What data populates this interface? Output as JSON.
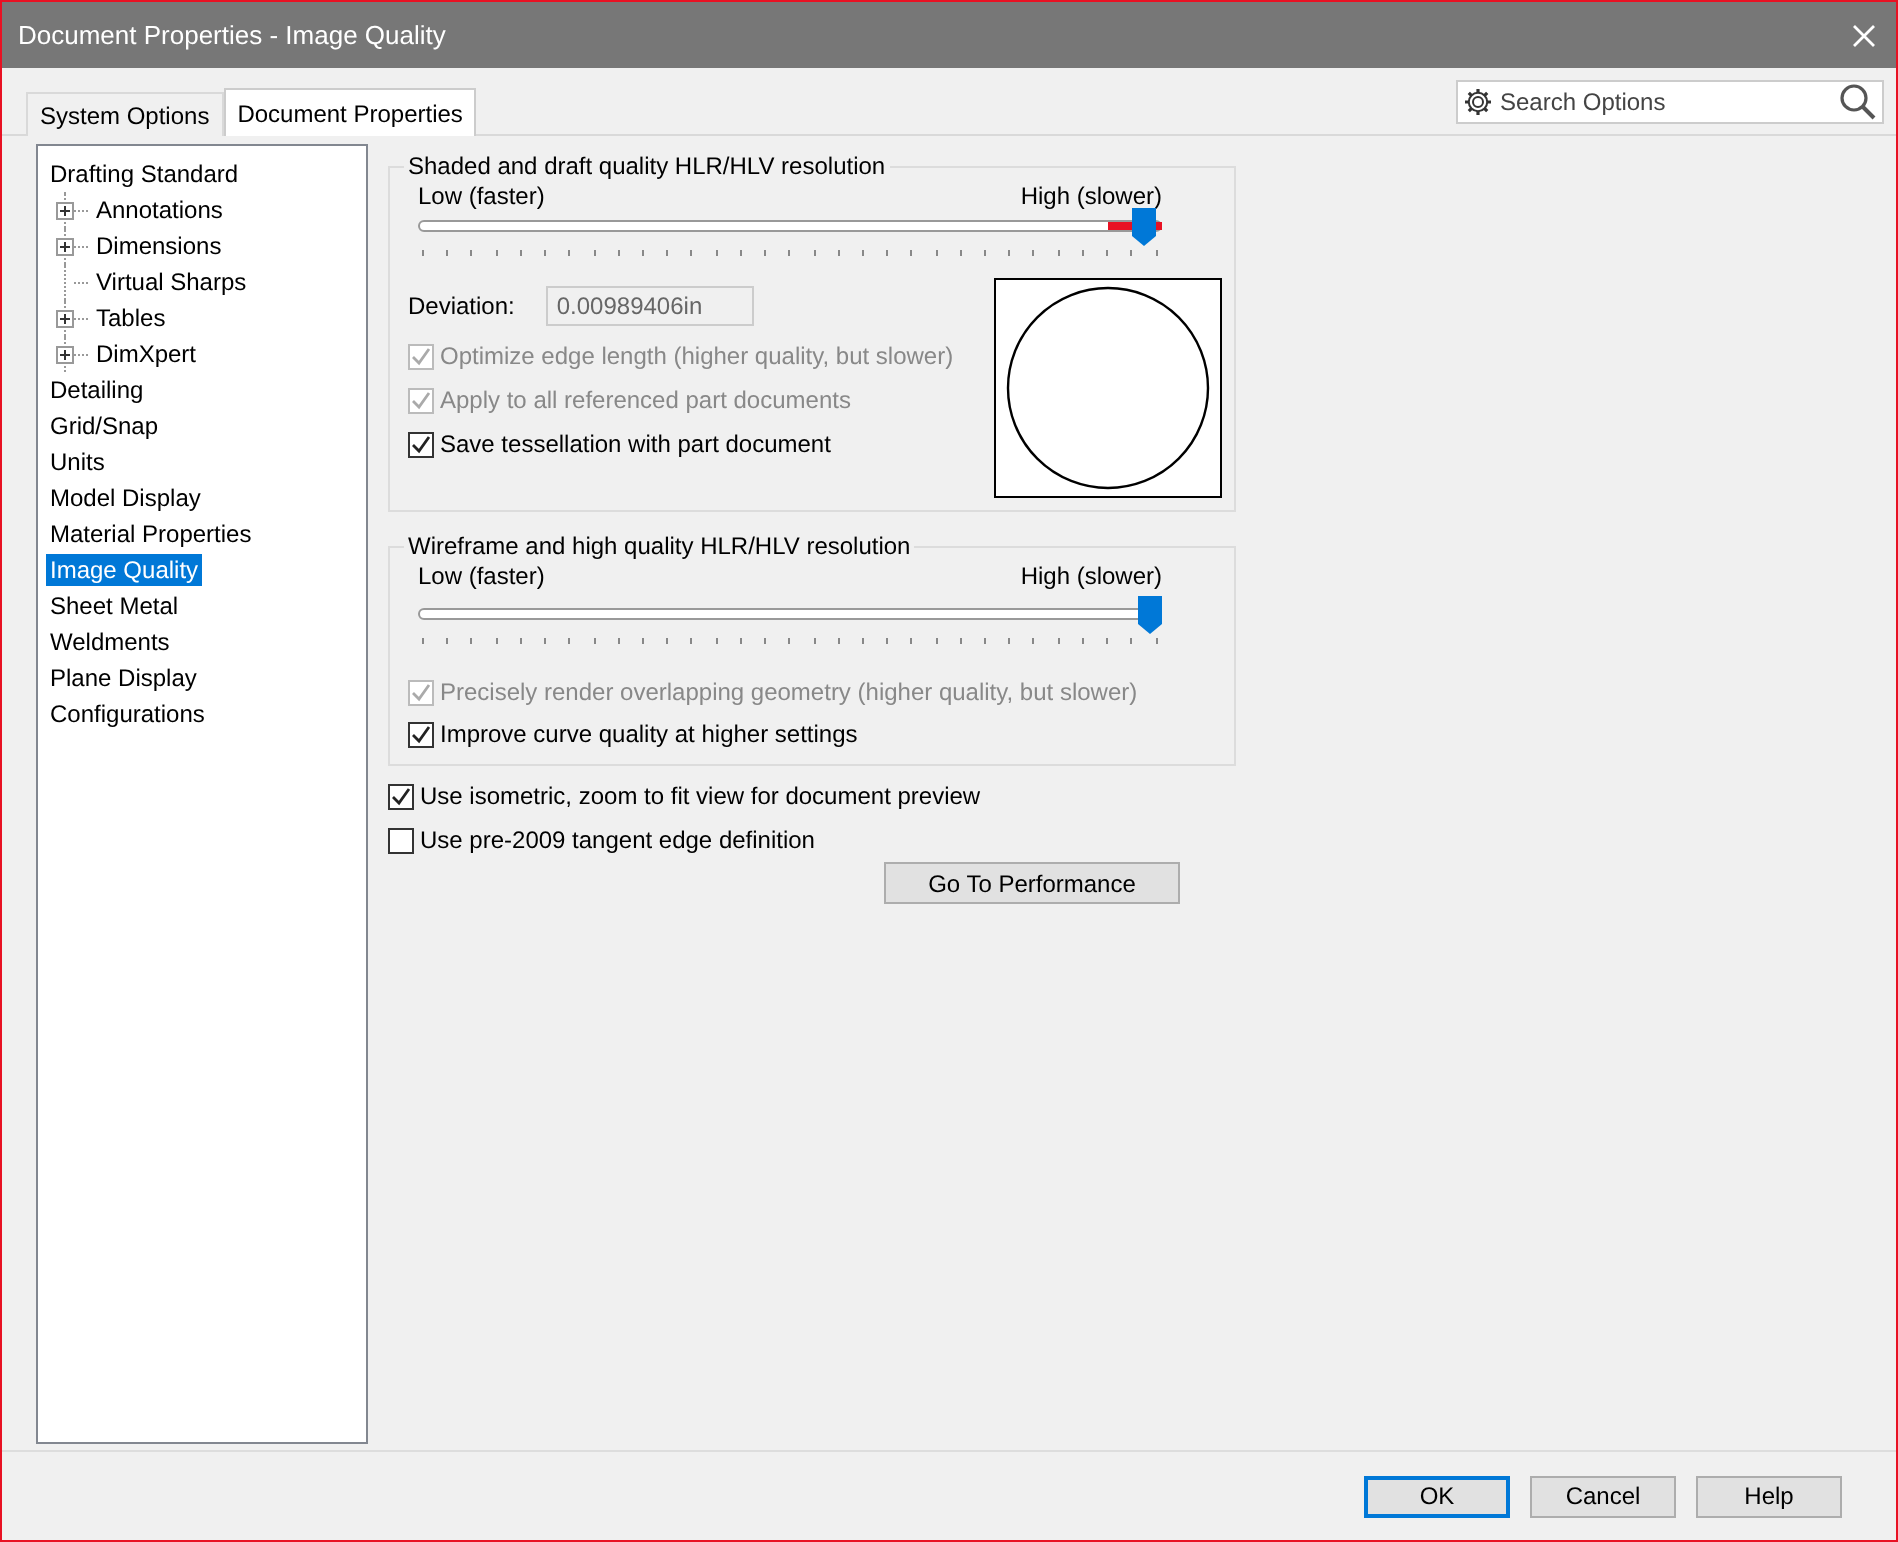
{
  "window": {
    "title": "Document Properties - Image Quality"
  },
  "tabs": [
    {
      "label": "System Options",
      "selected": false
    },
    {
      "label": "Document Properties",
      "selected": true
    }
  ],
  "search": {
    "placeholder": "Search Options"
  },
  "sidebar": {
    "items": [
      {
        "label": "Drafting Standard",
        "selected": false,
        "children": [
          {
            "label": "Annotations",
            "selected": false,
            "expanded": false
          },
          {
            "label": "Dimensions",
            "selected": false,
            "expanded": false
          },
          {
            "label": "Virtual Sharps",
            "selected": false
          },
          {
            "label": "Tables",
            "selected": false,
            "expanded": false
          },
          {
            "label": "DimXpert",
            "selected": false,
            "expanded": false
          }
        ]
      },
      {
        "label": "Detailing",
        "selected": false
      },
      {
        "label": "Grid/Snap",
        "selected": false
      },
      {
        "label": "Units",
        "selected": false
      },
      {
        "label": "Model Display",
        "selected": false
      },
      {
        "label": "Material Properties",
        "selected": false
      },
      {
        "label": "Image Quality",
        "selected": true
      },
      {
        "label": "Sheet Metal",
        "selected": false
      },
      {
        "label": "Weldments",
        "selected": false
      },
      {
        "label": "Plane Display",
        "selected": false
      },
      {
        "label": "Configurations",
        "selected": false
      }
    ]
  },
  "shaded_group": {
    "title": "Shaded and draft quality HLR/HLV resolution",
    "slider": {
      "low_label": "Low (faster)",
      "high_label": "High (slower)",
      "level": 0.975
    },
    "deviation": {
      "label": "Deviation:",
      "value": "0.00989406in"
    },
    "options": [
      {
        "label": "Optimize edge length (higher quality, but slower)",
        "checked": true,
        "disabled": true
      },
      {
        "label": "Apply to all referenced part documents",
        "checked": true,
        "disabled": true
      },
      {
        "label": "Save tessellation with part document",
        "checked": true,
        "disabled": false
      }
    ]
  },
  "wireframe_group": {
    "title": "Wireframe and high quality HLR/HLV resolution",
    "slider": {
      "low_label": "Low (faster)",
      "high_label": "High (slower)",
      "level": 0.985
    },
    "options": [
      {
        "label": "Precisely render overlapping geometry (higher quality, but slower)",
        "checked": true,
        "disabled": true
      },
      {
        "label": "Improve curve quality at higher settings",
        "checked": true,
        "disabled": false
      }
    ]
  },
  "options": [
    {
      "label": "Use isometric, zoom to fit view for document preview",
      "checked": true,
      "disabled": false
    },
    {
      "label": "Use pre-2009 tangent edge definition",
      "checked": false,
      "disabled": false
    }
  ],
  "performance_button": "Go To Performance",
  "buttons": [
    {
      "label": "OK",
      "default": true
    },
    {
      "label": "Cancel",
      "default": false
    },
    {
      "label": "Help",
      "default": false
    }
  ]
}
